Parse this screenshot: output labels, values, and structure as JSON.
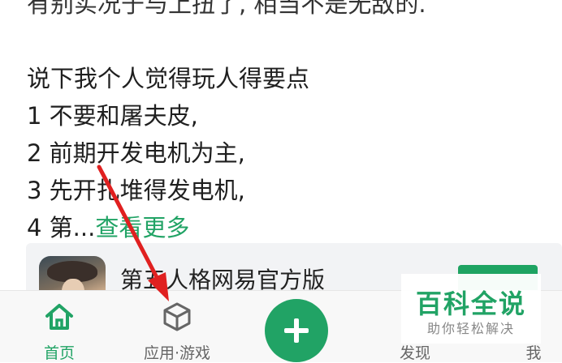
{
  "post": {
    "cut_line": "有别实况于与上扭了, 相当不是无敌的.",
    "heading": "说下我个人觉得玩人得要点",
    "lines": [
      "1 不要和屠夫皮,",
      "2 前期开发电机为主,",
      "3 先开扎堆得发电机,"
    ],
    "truncated_prefix": "4 第...",
    "more_link": "查看更多"
  },
  "app_card": {
    "name": "第五人格网易官方版"
  },
  "tabs": {
    "home": "首页",
    "apps_games": "应用·游戏",
    "discover": "发现",
    "me": "我"
  },
  "watermark": {
    "title": "百科全说",
    "subtitle": "助你轻松解决"
  },
  "colors": {
    "accent": "#21a365",
    "arrow": "#e02020"
  },
  "icons": {
    "home": "home-icon",
    "apps": "cube-icon",
    "publish": "plus-icon"
  }
}
